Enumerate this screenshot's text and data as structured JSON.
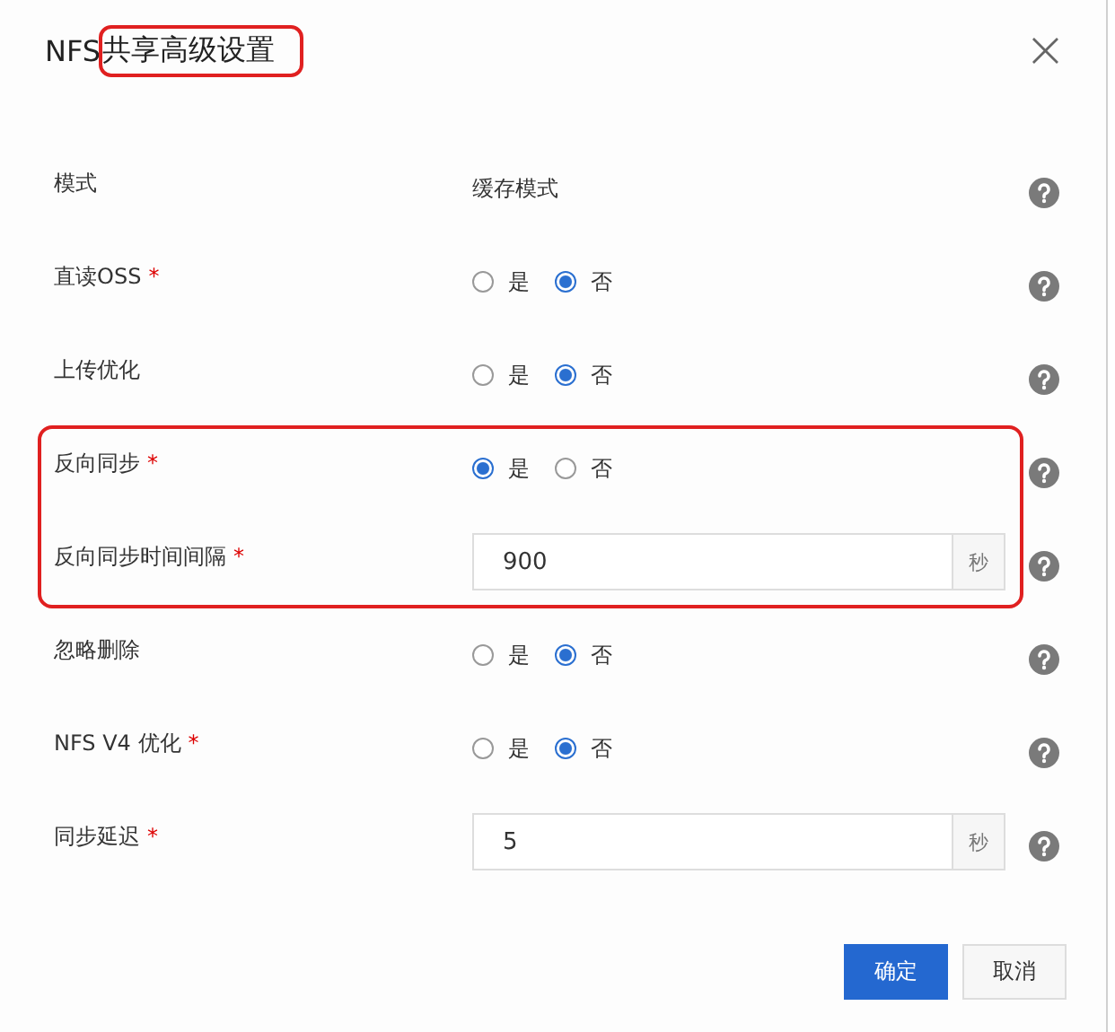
{
  "dialog": {
    "title_prefix": "NFS",
    "title_highlighted": "共享高级设置",
    "close": "×"
  },
  "sections": [
    {
      "highlighted": false,
      "rows": [
        {
          "kind": "text",
          "label": "模式",
          "value": "缓存模式"
        },
        {
          "kind": "radio",
          "label": "直读OSS",
          "required": "*",
          "options": [
            {
              "label": "是",
              "selected": false
            },
            {
              "label": "否",
              "selected": true
            }
          ]
        },
        {
          "kind": "radio",
          "label": "上传优化",
          "options": [
            {
              "label": "是",
              "selected": false
            },
            {
              "label": "否",
              "selected": true
            }
          ]
        }
      ]
    },
    {
      "highlighted": true,
      "rows": [
        {
          "kind": "radio",
          "label": "反向同步",
          "required": "*",
          "options": [
            {
              "label": "是",
              "selected": true
            },
            {
              "label": "否",
              "selected": false
            }
          ]
        },
        {
          "kind": "input",
          "label": "反向同步时间间隔",
          "required": "*",
          "value": "900",
          "unit": "秒"
        }
      ]
    },
    {
      "highlighted": false,
      "rows": [
        {
          "kind": "radio",
          "label": "忽略删除",
          "options": [
            {
              "label": "是",
              "selected": false
            },
            {
              "label": "否",
              "selected": true
            }
          ]
        },
        {
          "kind": "radio",
          "label": "NFS V4 优化",
          "required": "*",
          "options": [
            {
              "label": "是",
              "selected": false
            },
            {
              "label": "否",
              "selected": true
            }
          ]
        },
        {
          "kind": "input",
          "label": "同步延迟",
          "required": "*",
          "value": "5",
          "unit": "秒"
        }
      ]
    }
  ],
  "buttons": [
    {
      "label": "确定",
      "primary": true
    },
    {
      "label": "取消",
      "primary": false
    }
  ]
}
